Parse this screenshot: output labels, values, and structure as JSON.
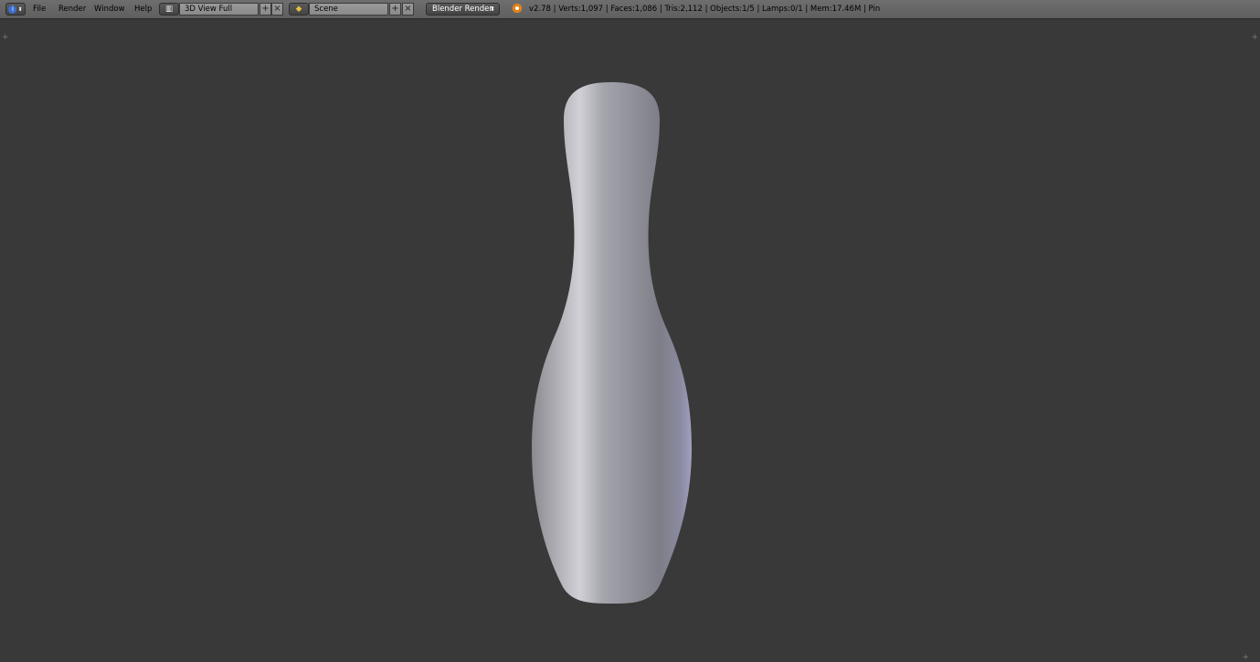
{
  "menu": {
    "file": "File",
    "render": "Render",
    "window": "Window",
    "help": "Help"
  },
  "screen_layout": {
    "value": "3D View Full"
  },
  "scene": {
    "value": "Scene"
  },
  "render_engine": {
    "value": "Blender Render"
  },
  "stats": "v2.78 | Verts:1,097 | Faces:1,086 | Tris:2,112 | Objects:1/5 | Lamps:0/1 | Mem:17.46M | Pin",
  "icons": {
    "info": "info-icon",
    "layout": "screen-layout-icon",
    "scene": "scene-icon",
    "add": "plus-icon",
    "remove": "x-icon",
    "blender": "blender-logo-icon"
  },
  "colors": {
    "background": "#393939",
    "header": "#666666",
    "mesh": "#9a9aa6"
  }
}
